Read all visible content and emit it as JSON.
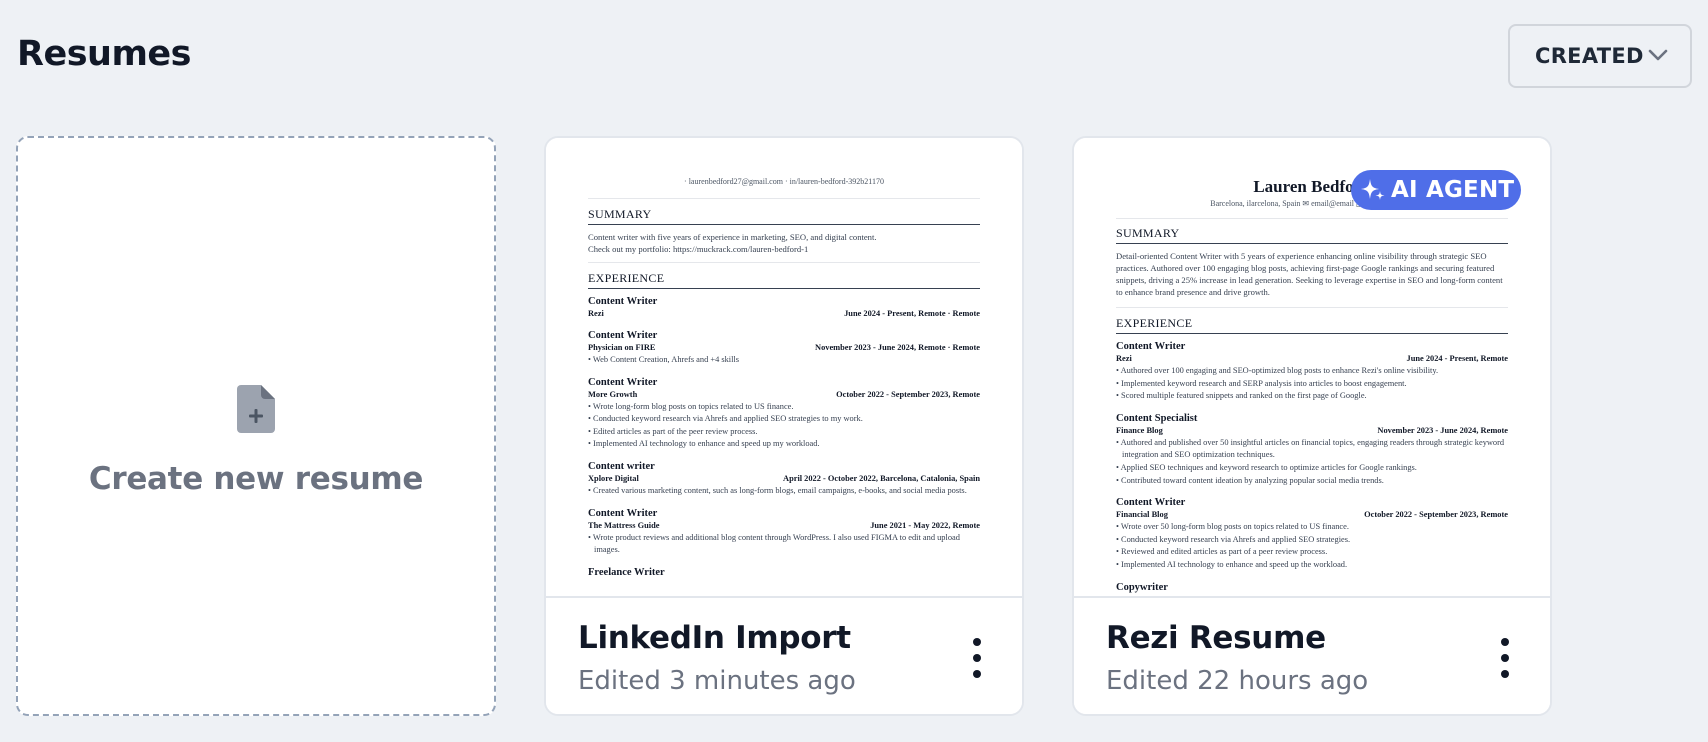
{
  "page": {
    "title": "Resumes"
  },
  "sort": {
    "label": "CREATED"
  },
  "create_card": {
    "label": "Create new resume"
  },
  "cards": [
    {
      "title": "LinkedIn Import",
      "subtitle": "Edited 3 minutes ago",
      "preview": {
        "contact": "·  laurenbedford27@gmail.com  ·  in/lauren-bedford-392b21170",
        "summary_heading": "SUMMARY",
        "summary": [
          "Content writer with five years of experience in marketing, SEO, and digital content.",
          "Check out my portfolio: https://muckrack.com/lauren-bedford-1"
        ],
        "experience_heading": "EXPERIENCE",
        "jobs": [
          {
            "title": "Content Writer",
            "company": "Rezi",
            "date": "June 2024 - Present,  Remote · Remote",
            "bullets": []
          },
          {
            "title": "Content Writer",
            "company": "Physician on FIRE",
            "date": "November 2023 - June 2024,  Remote · Remote",
            "bullets": [
              "Web Content Creation, Ahrefs and +4 skills"
            ]
          },
          {
            "title": "Content Writer",
            "company": "More Growth",
            "date": "October 2022 - September 2023,  Remote",
            "bullets": [
              "Wrote long-form blog posts on topics related to US finance.",
              "Conducted keyword research via Ahrefs and applied SEO strategies to my work.",
              "Edited articles as part of the peer review process.",
              "Implemented AI technology to enhance and speed up my workload."
            ]
          },
          {
            "title": "Content writer",
            "company": "Xplore Digital",
            "date": "April 2022 - October 2022,  Barcelona, Catalonia, Spain",
            "bullets": [
              "Created various marketing content, such as long-form blogs, email campaigns, e-books, and social media posts."
            ]
          },
          {
            "title": "Content Writer",
            "company": "The Mattress Guide",
            "date": "June 2021 - May 2022,  Remote",
            "bullets": [
              "Wrote product reviews and additional blog content through WordPress. I also used FIGMA to edit and upload images."
            ]
          },
          {
            "title": "Freelance Writer",
            "company": "",
            "date": "",
            "bullets": []
          }
        ]
      }
    },
    {
      "title": "Rezi Resume",
      "subtitle": "Edited 22 hours ago",
      "badge": "AI AGENT",
      "preview": {
        "name": "Lauren Bedford",
        "contact": "Barcelona, ilarcelona, Spain  ✉ email@email  ▯ (phone number)",
        "summary_heading": "SUMMARY",
        "summary": [
          "Detail-oriented Content Writer with 5 years of experience enhancing online visibility through strategic SEO practices. Authored over 100 engaging blog posts, achieving first-page Google rankings and securing featured snippets, driving a 25% increase in lead generation. Seeking to leverage expertise in SEO and long-form content to enhance brand presence and drive growth."
        ],
        "experience_heading": "EXPERIENCE",
        "jobs": [
          {
            "title": "Content Writer",
            "company": "Rezi",
            "date": "June 2024 - Present,  Remote",
            "bullets": [
              "Authored over 100 engaging and SEO-optimized blog posts to enhance Rezi's online visibility.",
              "Implemented keyword research and SERP analysis into articles to boost engagement.",
              "Scored multiple featured snippets and ranked on the first page of Google."
            ]
          },
          {
            "title": "Content Specialist",
            "company": "Finance Blog",
            "date": "November 2023 - June 2024,  Remote",
            "bullets": [
              "Authored and published over 50 insightful articles on financial topics, engaging readers through strategic keyword integration and SEO optimization techniques.",
              "Applied SEO techniques and keyword research to optimize articles for Google rankings.",
              "Contributed toward content ideation by analyzing popular social media trends."
            ]
          },
          {
            "title": "Content Writer",
            "company": "Financial Blog",
            "date": "October 2022 - September 2023,  Remote",
            "bullets": [
              "Wrote over 50 long-form blog posts on topics related to US finance.",
              "Conducted keyword research via Ahrefs and applied SEO strategies.",
              "Reviewed and edited articles as part of a peer review process.",
              "Implemented AI technology to enhance and speed up the workload."
            ]
          },
          {
            "title": "Copywriter",
            "company": "",
            "date": "",
            "bullets": []
          }
        ]
      }
    }
  ]
}
